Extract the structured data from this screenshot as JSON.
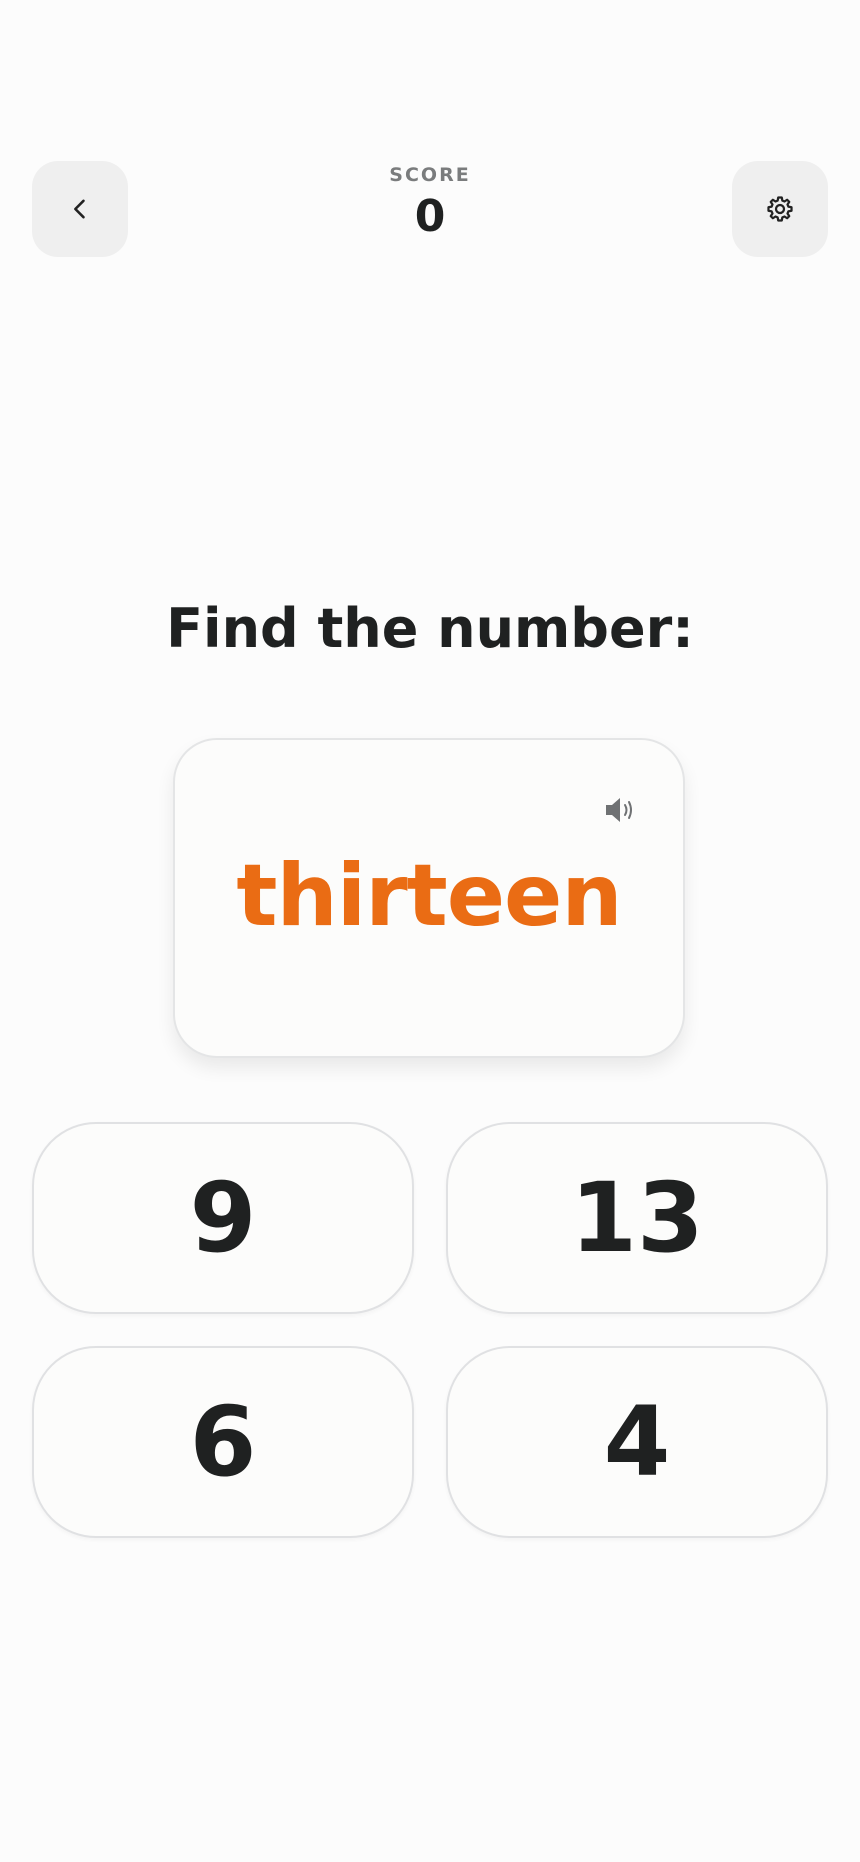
{
  "header": {
    "score_label": "SCORE",
    "score_value": "0"
  },
  "icons": {
    "back": "chevron-left-icon",
    "settings": "gear-icon",
    "audio": "speaker-icon"
  },
  "question": {
    "prompt": "Find the number:",
    "word": "thirteen"
  },
  "answers": [
    "9",
    "13",
    "6",
    "4"
  ],
  "colors": {
    "accent": "#ea6c14",
    "text": "#1f2121",
    "muted": "#7a7c7d",
    "button_bg": "#efefef",
    "card_border": "#e4e5e6"
  }
}
